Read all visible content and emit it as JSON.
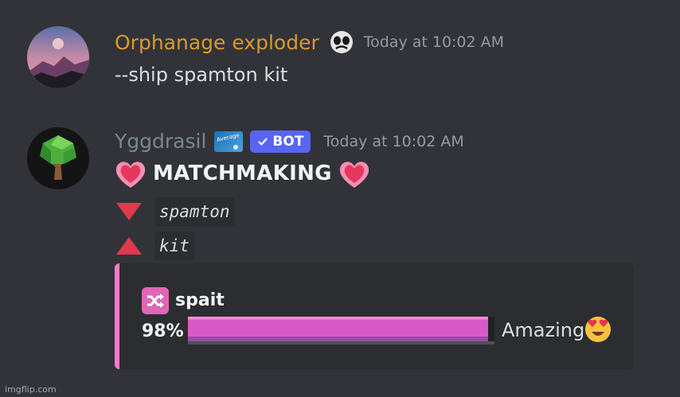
{
  "messages": [
    {
      "username": "Orphanage exploder",
      "username_color": "#d99a2e",
      "badge_icon": "skull-mask-emoji",
      "timestamp": "Today at 10:02 AM",
      "content": "--ship spamton kit"
    },
    {
      "username": "Yggdrasil",
      "username_color": "#7a8791",
      "role_badge_icon": "average-role-icon",
      "bot_tag": "BOT",
      "timestamp": "Today at 10:02 AM",
      "heading": "MATCHMAKING",
      "heart_icon": "sparkling-heart-emoji",
      "down_name": "spamton",
      "up_name": "kit",
      "embed": {
        "accent_color": "#ff79c6",
        "icon": "shuffle-icon",
        "title": "spait",
        "percent_label": "98%",
        "percent_value": 98,
        "verdict": "Amazing",
        "verdict_emoji": "heart-eyes-emoji"
      }
    }
  ],
  "watermark": "imgflip.com"
}
